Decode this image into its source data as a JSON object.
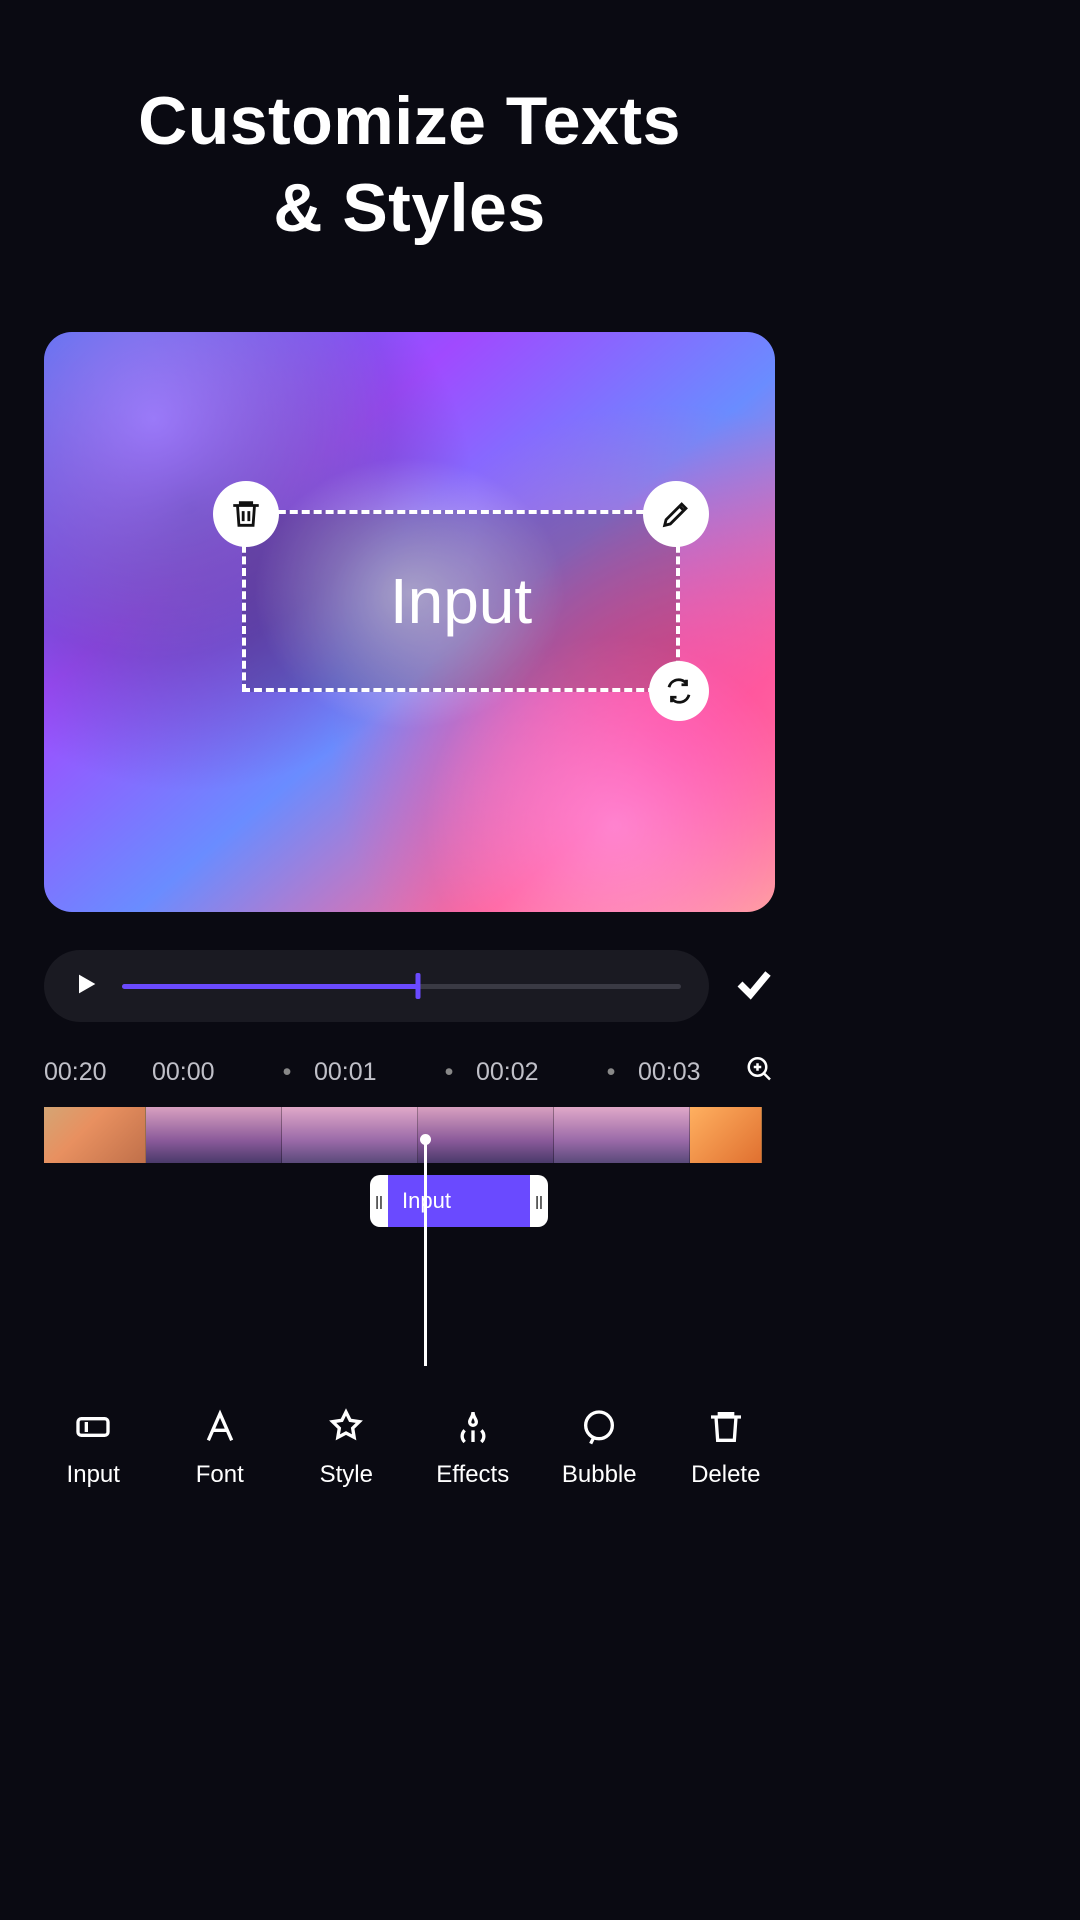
{
  "heading_line1": "Customize Texts",
  "heading_line2": "& Styles",
  "overlay": {
    "text": "Input"
  },
  "player": {
    "progress_pct": 53
  },
  "ruler": {
    "marks": [
      "00:20",
      "00:00",
      "00:01",
      "00:02",
      "00:03"
    ]
  },
  "text_clip": {
    "label": "Input"
  },
  "toolbar": {
    "input": "Input",
    "font": "Font",
    "style": "Style",
    "effects": "Effects",
    "bubble": "Bubble",
    "delete": "Delete"
  },
  "colors": {
    "accent": "#6a4aff",
    "bg": "#0a0a12"
  }
}
